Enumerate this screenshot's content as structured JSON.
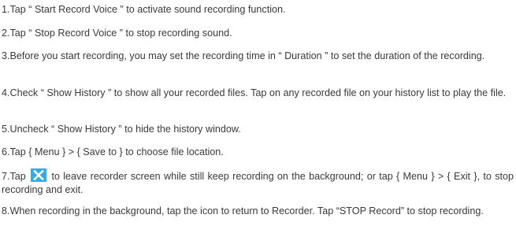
{
  "instructions": {
    "step1": "1.Tap “ Start Record Voice ” to activate sound recording function.",
    "step2": "2.Tap “ Stop Record Voice ” to stop recording sound.",
    "step3": "3.Before you start recording, you may set the recording time in “ Duration ” to set the duration of the recording.",
    "step4": "4.Check “ Show History ” to show all your recorded files. Tap on any recorded file on your history list to play the file.",
    "step5": "5.Uncheck “  Show History ” to hide the history window.",
    "step6": "6.Tap { Menu } > { Save to } to choose file location.",
    "step7_before_icon": "7.Tap",
    "step7_after_icon": "to leave recorder screen while still keep recording on the background; or tap { Menu } > { Exit }, to stop recording and exit.",
    "step8": "8.When recording in the background, tap the icon to return to Recorder. Tap “STOP Record” to stop recording."
  },
  "icons": {
    "close": {
      "name": "close-icon",
      "background": "#3aa9e0",
      "glyph_color": "#ffffff"
    }
  },
  "colors": {
    "text": "#3a3a3a"
  }
}
